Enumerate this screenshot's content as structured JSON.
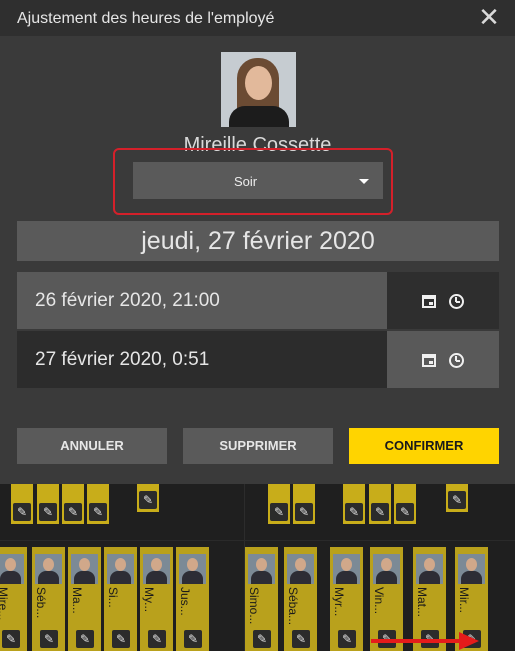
{
  "dialog": {
    "title": "Ajustement des heures de l'employé",
    "close_glyph": "✕",
    "employee_name": "Mireille Cossette",
    "shift_selected": "Soir",
    "date_banner": "jeudi, 27 février 2020",
    "start_datetime": "26 février 2020, 21:00",
    "end_datetime": "27 février 2020, 0:51",
    "buttons": {
      "cancel": "ANNULER",
      "delete": "SUPPRIMER",
      "confirm": "CONFIRMER"
    },
    "icons": [
      "close-icon",
      "avatar-photo",
      "chevron-down-icon",
      "calendar-icon",
      "clock-icon"
    ]
  },
  "schedule": {
    "edit_glyph": "✎",
    "employees": [
      {
        "name": "Mire..."
      },
      {
        "name": "Séb..."
      },
      {
        "name": "Ma..."
      },
      {
        "name": "Si..."
      },
      {
        "name": "My..."
      },
      {
        "name": "Jus..."
      },
      {
        "name": "Simo..."
      },
      {
        "name": "Séba..."
      },
      {
        "name": "Myr..."
      },
      {
        "name": "Vin..."
      },
      {
        "name": "Mat..."
      },
      {
        "name": "Mir..."
      }
    ]
  },
  "colors": {
    "accent": "#ffd400",
    "tile": "#c8ad1a",
    "annotation": "#d4202a"
  }
}
